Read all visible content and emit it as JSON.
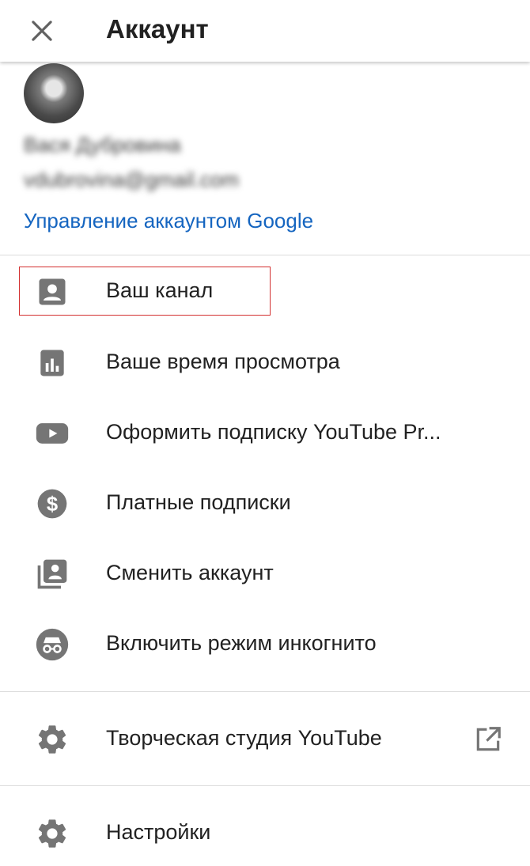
{
  "header": {
    "title": "Аккаунт",
    "close_icon": "close-icon"
  },
  "account": {
    "name": "Вася Дубровина",
    "email": "vdubrovina@gmail.com",
    "manage_link": "Управление аккаунтом Google"
  },
  "menu": {
    "items": [
      {
        "label": "Ваш канал",
        "icon": "account-box-icon"
      },
      {
        "label": "Ваше время просмотра",
        "icon": "bar-chart-icon"
      },
      {
        "label": "Оформить подписку YouTube Pr...",
        "icon": "youtube-play-icon"
      },
      {
        "label": "Платные подписки",
        "icon": "dollar-circle-icon"
      },
      {
        "label": "Сменить аккаунт",
        "icon": "switch-account-icon"
      },
      {
        "label": "Включить режим инкогнито",
        "icon": "incognito-icon"
      }
    ],
    "secondary": [
      {
        "label": "Творческая студия YouTube",
        "icon": "gear-icon",
        "trailing_icon": "open-external-icon"
      },
      {
        "label": "Настройки",
        "icon": "gear-icon"
      }
    ]
  },
  "colors": {
    "link": "#1565c0",
    "icon": "#757575",
    "highlight": "#d32f2f"
  }
}
